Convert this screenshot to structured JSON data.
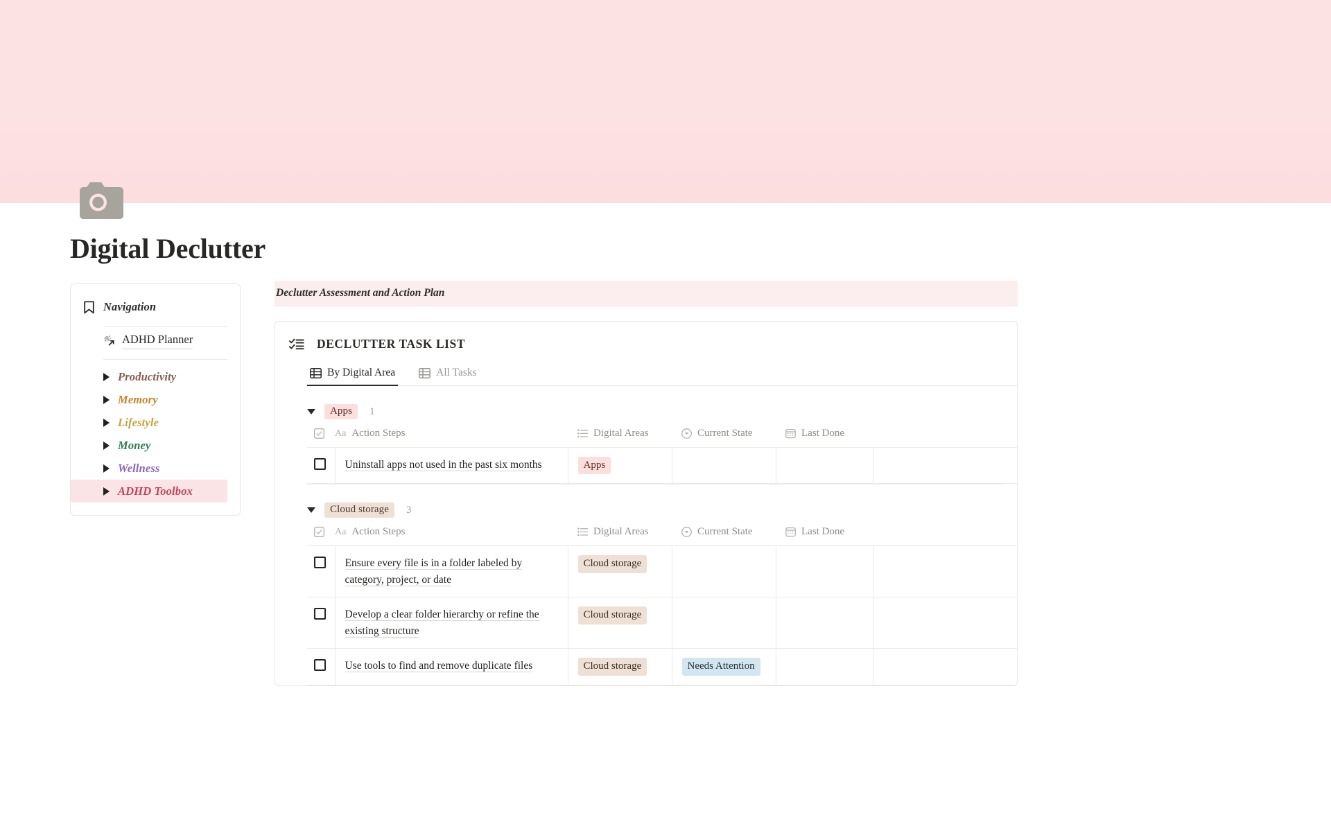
{
  "cover": {
    "color_top": "#fde2e3",
    "color_bottom": "#fdddde"
  },
  "page": {
    "icon": "camera-icon",
    "title": "Digital Declutter"
  },
  "sidebar": {
    "header_label": "Navigation",
    "header_icon": "bookmark-icon",
    "link": {
      "label": "ADHD Planner",
      "icon": "page-link-icon"
    },
    "items": [
      {
        "label": "Productivity",
        "color": "#8a5a4e",
        "highlight": false
      },
      {
        "label": "Memory",
        "color": "#c98229",
        "highlight": false
      },
      {
        "label": "Lifestyle",
        "color": "#c8a13a",
        "highlight": false
      },
      {
        "label": "Money",
        "color": "#2f7a52",
        "highlight": false
      },
      {
        "label": "Wellness",
        "color": "#8b66c2",
        "highlight": false
      },
      {
        "label": "ADHD Toolbox",
        "color": "#c2445b",
        "highlight": true
      }
    ]
  },
  "main": {
    "callout": "Declutter Assessment and Action Plan",
    "database": {
      "icon": "checklist-icon",
      "title": "DECLUTTER TASK LIST",
      "tabs": [
        {
          "label": "By Digital Area",
          "icon": "table-icon",
          "active": true
        },
        {
          "label": "All Tasks",
          "icon": "table-icon",
          "active": false
        }
      ],
      "columns": [
        {
          "label": "Action Steps",
          "icon": "text-aa-icon"
        },
        {
          "label": "Digital Areas",
          "icon": "multiselect-icon"
        },
        {
          "label": "Current State",
          "icon": "select-icon"
        },
        {
          "label": "Last Done",
          "icon": "calendar-icon"
        }
      ],
      "groups": [
        {
          "name": "Apps",
          "badge_style": "badge-apps",
          "count": "1",
          "rows": [
            {
              "checked": false,
              "action": "Uninstall apps not used in the past six months",
              "areas": {
                "label": "Apps",
                "style": "pill-apps"
              },
              "state": "",
              "last_done": ""
            }
          ]
        },
        {
          "name": "Cloud storage",
          "badge_style": "badge-cloud",
          "count": "3",
          "rows": [
            {
              "checked": false,
              "action": "Ensure every file is in a folder labeled by category, project, or date",
              "areas": {
                "label": "Cloud storage",
                "style": "pill-cloud"
              },
              "state": "",
              "last_done": ""
            },
            {
              "checked": false,
              "action": "Develop a clear folder hierarchy or refine the existing structure",
              "areas": {
                "label": "Cloud storage",
                "style": "pill-cloud"
              },
              "state": "",
              "last_done": ""
            },
            {
              "checked": false,
              "action": "Use tools to find and remove duplicate files",
              "areas": {
                "label": "Cloud storage",
                "style": "pill-cloud"
              },
              "state": "Needs Attention",
              "state_style": "pill-attn",
              "last_done": ""
            }
          ]
        }
      ]
    }
  }
}
